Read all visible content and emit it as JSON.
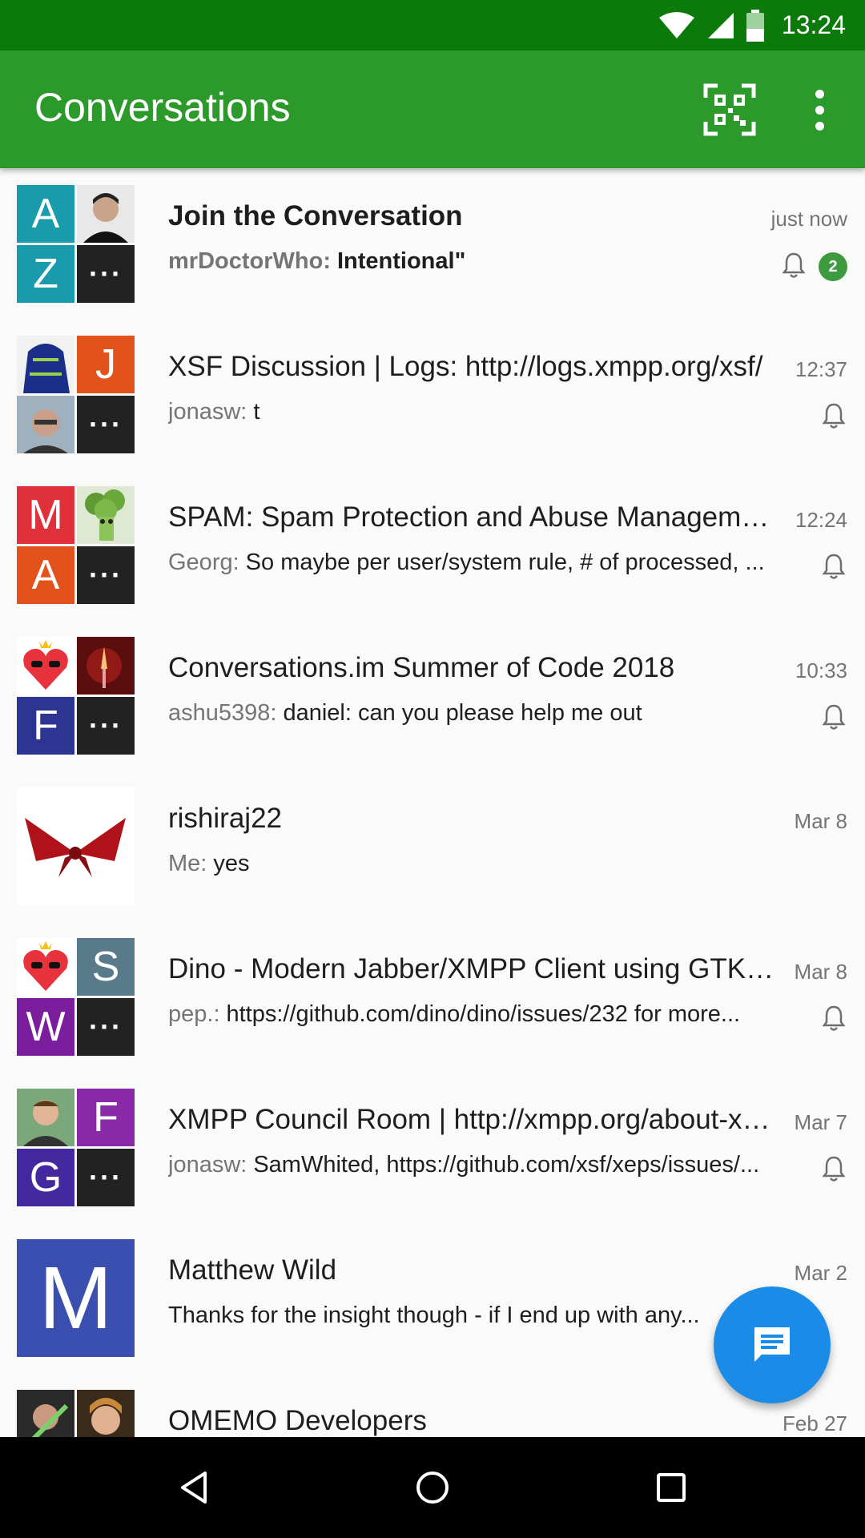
{
  "status": {
    "time": "13:24"
  },
  "appbar": {
    "title": "Conversations"
  },
  "conversations": [
    {
      "title": "Join the Conversation",
      "time": "just now",
      "sender": "mrDoctorWho:",
      "message": "Intentional\"",
      "badge": "2",
      "avatar": {
        "t00": {
          "text": "A",
          "color": "#1a9bab"
        },
        "t01": {
          "text": "Z",
          "color": "#1a9bab"
        },
        "t10": {
          "text": "",
          "color": "#d9d9d9"
        }
      }
    },
    {
      "title": "XSF Discussion | Logs: http://logs.xmpp.org/xsf/",
      "time": "12:37",
      "sender": "jonasw:",
      "message": "t",
      "avatar": {
        "t00": {
          "text": "",
          "color": "#1e3a8a"
        },
        "t10": {
          "text": "J",
          "color": "#e2531c"
        },
        "t01": {
          "text": "",
          "color": "#8fa3b5"
        }
      }
    },
    {
      "title": "SPAM: Spam Protection and Abuse Management",
      "time": "12:24",
      "sender": "Georg:",
      "message": "So maybe per user/system rule, # of processed, ...",
      "avatar": {
        "t00": {
          "text": "M",
          "color": "#e0313a"
        },
        "t10": {
          "text": "",
          "color": "#7cae4a"
        },
        "t01": {
          "text": "A",
          "color": "#e4521b"
        }
      }
    },
    {
      "title": "Conversations.im Summer of Code 2018",
      "time": "10:33",
      "sender": "ashu5398:",
      "message": "daniel: can you please help me out",
      "avatar": {
        "t00": {
          "text": "",
          "color": "#ffffff"
        },
        "t10": {
          "text": "",
          "color": "#6b1414"
        },
        "t01": {
          "text": "F",
          "color": "#2c3591"
        }
      }
    },
    {
      "title": "rishiraj22",
      "time": "Mar 8",
      "sender": "Me:",
      "message": "yes"
    },
    {
      "title": "Dino - Modern Jabber/XMPP Client using GTK+/Vala",
      "time": "Mar 8",
      "sender": "pep.:",
      "message": "https://github.com/dino/dino/issues/232 for more...",
      "avatar": {
        "t00": {
          "text": "",
          "color": "#ffffff"
        },
        "t10": {
          "text": "S",
          "color": "#587a8b"
        },
        "t01": {
          "text": "W",
          "color": "#7a1e9e"
        }
      }
    },
    {
      "title": "XMPP Council Room | http://xmpp.org/about-xmpp/",
      "time": "Mar 7",
      "sender": "jonasw:",
      "message": "SamWhited, https://github.com/xsf/xeps/issues/...",
      "avatar": {
        "t00": {
          "text": "",
          "color": "#6a9c6a"
        },
        "t10": {
          "text": "F",
          "color": "#8a2aa8"
        },
        "t01": {
          "text": "G",
          "color": "#4428a0"
        }
      }
    },
    {
      "title": "Matthew Wild",
      "time": "Mar 2",
      "sender": "",
      "message": "Thanks for the insight though - if I end up with any...",
      "avatar": {
        "big": {
          "text": "M",
          "color": "#3a4fb0"
        }
      }
    },
    {
      "title": "OMEMO Developers",
      "time": "Feb 27",
      "sender": "",
      "message": ""
    }
  ],
  "more_label": "···"
}
